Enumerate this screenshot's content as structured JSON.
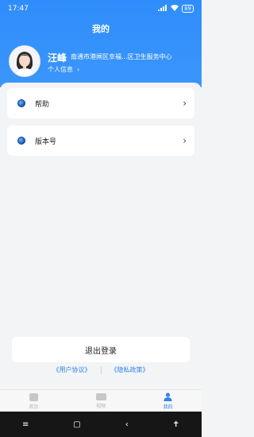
{
  "status_bar": {
    "time": "17:47",
    "signal_text": "5G",
    "battery": "89"
  },
  "header": {
    "title": "我的"
  },
  "user": {
    "name": "汪峰",
    "org": "南通市港闸区幸福...区卫生服务中心",
    "personal_info": "个人信息",
    "arrow": "›"
  },
  "menu": [
    {
      "label": "帮助",
      "chevron": "›"
    },
    {
      "label": "版本号",
      "chevron": "›"
    }
  ],
  "logout_label": "退出登录",
  "links": {
    "user_agreement": "《用户协议》",
    "privacy_policy": "《隐私政策》"
  },
  "tabs": [
    {
      "label": "首页",
      "icon": "home-icon",
      "active": false
    },
    {
      "label": "视频",
      "icon": "video-icon",
      "active": false
    },
    {
      "label": "我的",
      "icon": "user-icon",
      "active": true
    }
  ],
  "nav": {
    "menu": "≡",
    "home": "▢",
    "back": "‹",
    "accessibility": "✝"
  },
  "colors": {
    "primary": "#2f86e8",
    "header": "#2f8dfb",
    "background": "#f3f4f6"
  }
}
